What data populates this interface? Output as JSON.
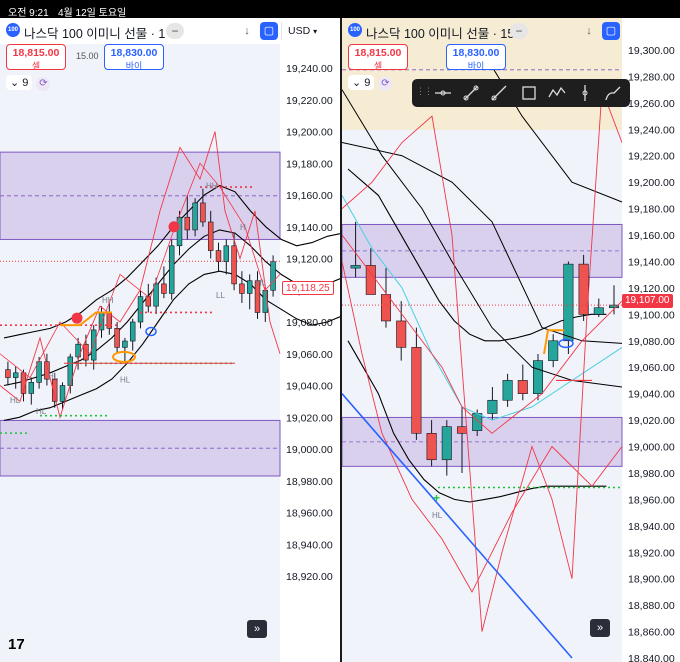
{
  "status_bar": {
    "time": "오전 9:21",
    "date": "4월 12일 토요일"
  },
  "colors": {
    "zone_fill": "#d1c4e9",
    "zone_line": "#7e57c2",
    "up": "#26a69a",
    "down": "#ef5350",
    "bb": "#000000",
    "env": "#f23645"
  },
  "left_chart": {
    "logo": "100",
    "symbol": "나스닥 100 이미니 선물 · 1",
    "currency": "USD",
    "sell_price": "18,815.00",
    "sell_label": "셀",
    "buy_price": "18,830.00",
    "buy_label": "바이",
    "spread": "15.00",
    "indicator_count": "9",
    "current_price": "19,118.25",
    "labels": [
      "HH",
      "HL",
      "HL",
      "HL",
      "HH",
      "H",
      "LL",
      "HL",
      "HL"
    ]
  },
  "right_chart": {
    "logo": "100",
    "symbol": "나스닥 100 이미니 선물 · 15",
    "currency": "USD",
    "sell_price": "18,815.00",
    "sell_label": "셀",
    "buy_price": "18,830.00",
    "buy_label": "바이",
    "indicator_count": "9",
    "current_price": "19,107.00",
    "labels": [
      "HL"
    ]
  },
  "chart_data": [
    {
      "type": "candlestick",
      "title": "나스닥 100 이미니 선물 · 1",
      "currency": "USD",
      "y_ticks": [
        19240,
        19220,
        19200,
        19180,
        19160,
        19140,
        19120,
        19100,
        19080,
        19060,
        19040,
        19020,
        19000,
        18980,
        18960,
        18940,
        18920
      ],
      "ylim": [
        18915,
        19252
      ],
      "last_price": 19118.25,
      "zones": [
        [
          19132,
          19187
        ],
        [
          18983,
          19018
        ]
      ],
      "candles": [
        [
          19050,
          19055,
          19040,
          19045
        ],
        [
          19045,
          19052,
          19038,
          19048
        ],
        [
          19048,
          19050,
          19030,
          19035
        ],
        [
          19035,
          19045,
          19028,
          19042
        ],
        [
          19042,
          19058,
          19038,
          19055
        ],
        [
          19055,
          19060,
          19040,
          19044
        ],
        [
          19044,
          19048,
          19026,
          19030
        ],
        [
          19030,
          19042,
          19025,
          19040
        ],
        [
          19040,
          19060,
          19035,
          19058
        ],
        [
          19058,
          19070,
          19050,
          19066
        ],
        [
          19066,
          19072,
          19052,
          19056
        ],
        [
          19056,
          19078,
          19050,
          19075
        ],
        [
          19075,
          19090,
          19070,
          19086
        ],
        [
          19086,
          19092,
          19072,
          19076
        ],
        [
          19076,
          19080,
          19060,
          19064
        ],
        [
          19064,
          19070,
          19055,
          19068
        ],
        [
          19068,
          19082,
          19062,
          19080
        ],
        [
          19080,
          19100,
          19076,
          19096
        ],
        [
          19096,
          19104,
          19086,
          19090
        ],
        [
          19090,
          19108,
          19085,
          19104
        ],
        [
          19104,
          19115,
          19095,
          19098
        ],
        [
          19098,
          19132,
          19094,
          19128
        ],
        [
          19128,
          19150,
          19122,
          19146
        ],
        [
          19146,
          19160,
          19132,
          19138
        ],
        [
          19138,
          19158,
          19134,
          19155
        ],
        [
          19155,
          19164,
          19140,
          19143
        ],
        [
          19143,
          19150,
          19120,
          19125
        ],
        [
          19125,
          19130,
          19112,
          19118
        ],
        [
          19118,
          19132,
          19110,
          19128
        ],
        [
          19128,
          19136,
          19100,
          19104
        ],
        [
          19104,
          19112,
          19092,
          19098
        ],
        [
          19098,
          19110,
          19088,
          19106
        ],
        [
          19106,
          19112,
          19082,
          19086
        ],
        [
          19086,
          19102,
          19080,
          19100
        ],
        [
          19100,
          19122,
          19096,
          19118
        ]
      ],
      "series": [
        {
          "name": "upper_band",
          "values": [
            19070,
            19072,
            19074,
            19076,
            19080,
            19086,
            19094,
            19100,
            19108,
            19118,
            19128,
            19140,
            19150,
            19160,
            19166,
            19162,
            19150,
            19140,
            19132,
            19128,
            19130,
            19134,
            19136,
            19132,
            19126
          ]
        },
        {
          "name": "basis",
          "values": [
            19040,
            19042,
            19045,
            19048,
            19052,
            19056,
            19062,
            19070,
            19080,
            19092,
            19104,
            19116,
            19126,
            19134,
            19138,
            19136,
            19128,
            19118,
            19110,
            19104,
            19102,
            19104,
            19108,
            19110,
            19112
          ]
        },
        {
          "name": "lower_band",
          "values": [
            19018,
            19020,
            19024,
            19026,
            19030,
            19034,
            19038,
            19044,
            19054,
            19066,
            19080,
            19094,
            19104,
            19110,
            19112,
            19110,
            19104,
            19094,
            19088,
            19082,
            19078,
            19080,
            19084,
            19088,
            19092
          ]
        }
      ]
    },
    {
      "type": "candlestick",
      "title": "나스닥 100 이미니 선물 · 15",
      "currency": "USD",
      "y_ticks": [
        19300,
        19280,
        19260,
        19240,
        19220,
        19200,
        19180,
        19160,
        19140,
        19120,
        19100,
        19080,
        19060,
        19040,
        19020,
        19000,
        18980,
        18960,
        18940,
        18920,
        18900,
        18880,
        18860,
        18840
      ],
      "ylim": [
        18838,
        19302
      ],
      "last_price": 19107.0,
      "zones": [
        [
          19128,
          19168
        ],
        [
          18985,
          19022
        ]
      ],
      "candles": [
        [
          19135,
          19170,
          19128,
          19137
        ],
        [
          19137,
          19150,
          19120,
          19115
        ],
        [
          19115,
          19135,
          19090,
          19095
        ],
        [
          19095,
          19110,
          19065,
          19075
        ],
        [
          19075,
          19090,
          19005,
          19010
        ],
        [
          19010,
          19020,
          18985,
          18990
        ],
        [
          18990,
          19020,
          18978,
          19015
        ],
        [
          19015,
          19030,
          18980,
          19010
        ],
        [
          19012,
          19028,
          19008,
          19025
        ],
        [
          19025,
          19045,
          19020,
          19035
        ],
        [
          19035,
          19055,
          19030,
          19050
        ],
        [
          19050,
          19062,
          19035,
          19040
        ],
        [
          19040,
          19070,
          19035,
          19065
        ],
        [
          19065,
          19085,
          19060,
          19080
        ],
        [
          19080,
          19140,
          19070,
          19138
        ],
        [
          19138,
          19145,
          19095,
          19100
        ],
        [
          19100,
          19112,
          19098,
          19105
        ],
        [
          19105,
          19122,
          19100,
          19107
        ]
      ],
      "series": [
        {
          "name": "upper_band",
          "values": [
            19210,
            19200,
            19190,
            19170,
            19150,
            19130,
            19110,
            19095,
            19085,
            19080,
            19080,
            19082,
            19085,
            19090,
            19095,
            19098,
            19100,
            19100
          ]
        },
        {
          "name": "lower_band",
          "values": [
            19080,
            19060,
            19040,
            19010,
            18990,
            18975,
            18965,
            18960,
            18958,
            18960,
            18962,
            18965,
            18968,
            18970,
            18970,
            18970,
            18970,
            18970
          ]
        }
      ]
    }
  ]
}
